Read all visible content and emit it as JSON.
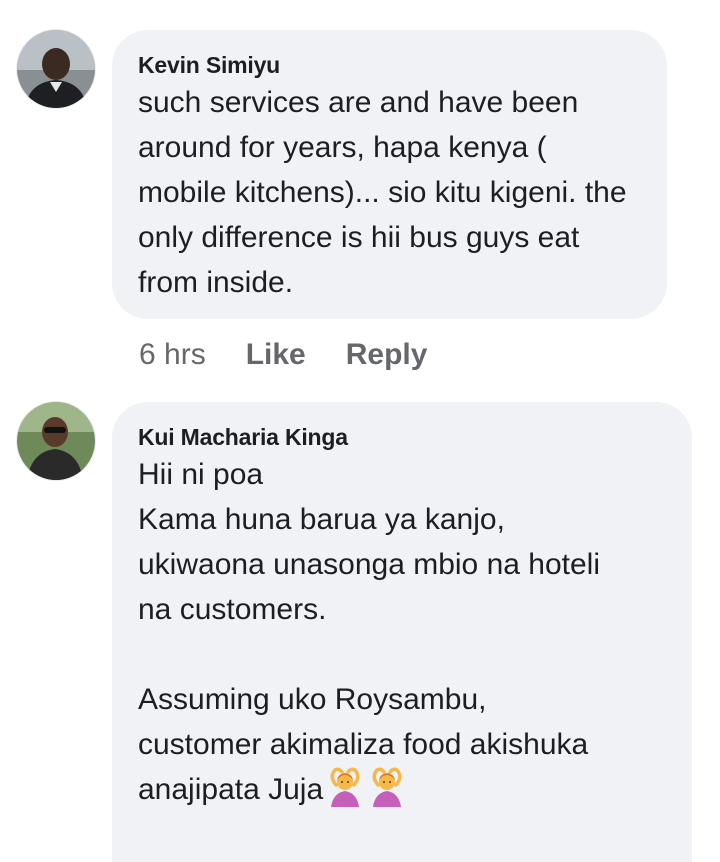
{
  "comments": [
    {
      "author": "Kevin Simiyu",
      "text": "such services are and have been around for years, hapa kenya ( mobile kitchens)... sio kitu kigeni. the only difference is hii bus guys eat from inside.",
      "time": "6 hrs",
      "like_label": "Like",
      "reply_label": "Reply"
    },
    {
      "author": "Kui Macharia Kinga",
      "text_lines": [
        "Hii ni poa",
        "Kama huna barua ya kanjo,",
        "ukiwaona unasonga mbio na hoteli",
        "na customers.",
        "",
        "Assuming uko Roysambu,",
        "customer akimaliza food akishuka",
        "anajipata Juja"
      ],
      "emojis": [
        "person-gesturing-ok-emoji",
        "person-gesturing-ok-emoji"
      ]
    }
  ],
  "colors": {
    "bubble": "#f0f2f5",
    "meta_text": "#65676b",
    "text": "#1c1e21"
  }
}
